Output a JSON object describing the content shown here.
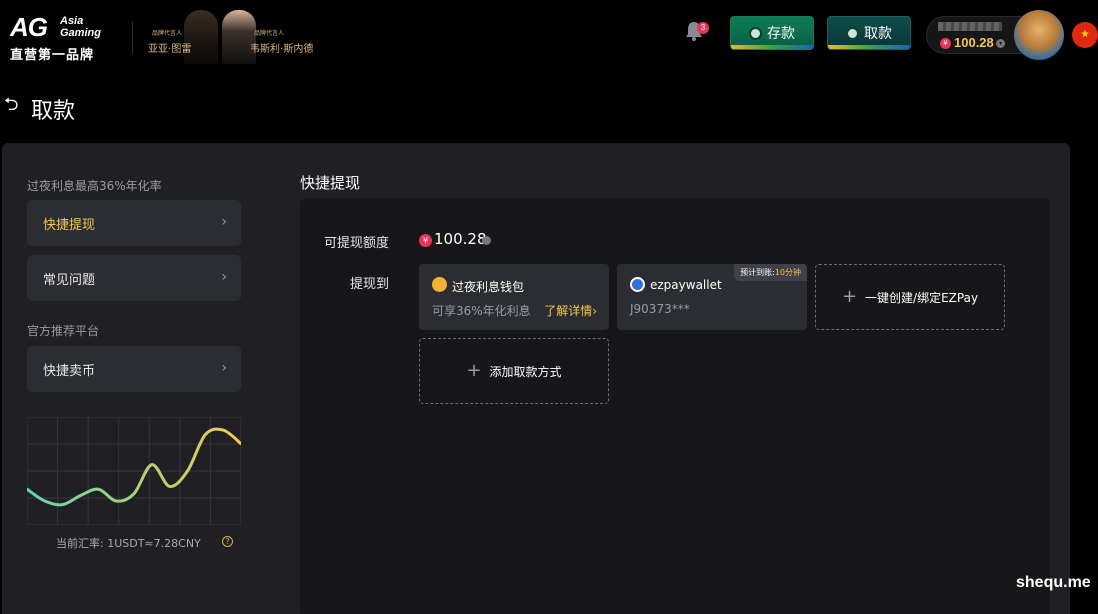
{
  "header": {
    "logo": "AG",
    "logo_sub1": "Asia",
    "logo_sub2": "Gaming",
    "logo_slogan": "直营第一品牌",
    "ambassador": {
      "role1": "品牌代言人",
      "name1": "亚亚·图雷",
      "role2": "品牌代言人",
      "name2": "韦斯利·斯内德"
    },
    "notification_count": "3",
    "deposit_label": "存款",
    "withdraw_label": "取款",
    "balance": "100.28",
    "currency_symbol": "¥"
  },
  "page": {
    "title": "取款"
  },
  "sidebar": {
    "caption1": "过夜利息最高36%年化率",
    "items": [
      {
        "label": "快捷提现"
      },
      {
        "label": "常见问题"
      }
    ],
    "caption2": "官方推荐平台",
    "items2": [
      {
        "label": "快捷卖币"
      }
    ],
    "rate_text": "当前汇率: 1USDT≈7.28CNY"
  },
  "main": {
    "section_title": "快捷提现",
    "available_label": "可提现额度",
    "available_amount": "100.28",
    "withdraw_to_label": "提现到",
    "cards": [
      {
        "name": "过夜利息钱包",
        "sub": "可享36%年化利息",
        "link": "了解详情›"
      },
      {
        "name": "ezpaywallet",
        "sub": "J90373***",
        "tag_prefix": "预计到账:",
        "tag_value": "10分钟"
      }
    ],
    "bind_ezpay_label": "一键创建/绑定EZPay",
    "add_method_label": "添加取款方式"
  },
  "watermark": "shequ.me",
  "colors": {
    "accent_gold": "#f2c94c",
    "panel": "#202024",
    "card": "#2c2d33",
    "curve_start": "#5fd6b4",
    "curve_end": "#f2c94c"
  },
  "chart_data": {
    "type": "line",
    "x": [
      0,
      1,
      2,
      3,
      4,
      5,
      6,
      7,
      8,
      9,
      10,
      11,
      12
    ],
    "series": [
      {
        "values": [
          0.35,
          0.22,
          0.18,
          0.28,
          0.35,
          0.22,
          0.3,
          0.62,
          0.38,
          0.55,
          0.95,
          1.0,
          0.85
        ]
      }
    ],
    "ylim": [
      0,
      1.1
    ],
    "grid": true
  }
}
